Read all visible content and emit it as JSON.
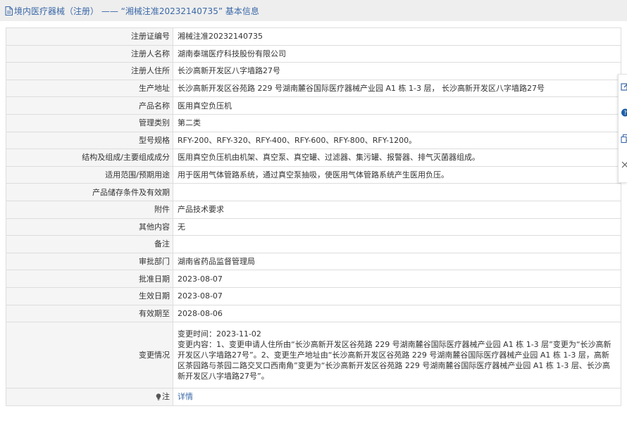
{
  "header": {
    "title": "境内医疗器械（注册） —— “湘械注准20232140735” 基本信息",
    "icon": "document-icon"
  },
  "rows": [
    {
      "label": "注册证编号",
      "value": "湘械注准20232140735"
    },
    {
      "label": "注册人名称",
      "value": "湖南泰瑞医疗科技股份有限公司"
    },
    {
      "label": "注册人住所",
      "value": "长沙高新开发区八字墙路27号"
    },
    {
      "label": "生产地址",
      "value": "长沙高新开发区谷苑路 229 号湖南麓谷国际医疗器械产业园 A1 栋 1-3 层， 长沙高新开发区八字墙路27号"
    },
    {
      "label": "产品名称",
      "value": "医用真空负压机"
    },
    {
      "label": "管理类别",
      "value": "第二类"
    },
    {
      "label": "型号规格",
      "value": "RFY-200、RFY-320、RFY-400、RFY-600、RFY-800、RFY-1200。"
    },
    {
      "label": "结构及组成/主要组成成分",
      "value": "医用真空负压机由机架、真空泵、真空罐、过滤器、集污罐、报警器、排气灭菌器组成。"
    },
    {
      "label": "适用范围/预期用途",
      "value": "用于医用气体管路系统，通过真空泵抽吸，使医用气体管路系统产生医用负压。"
    },
    {
      "label": "产品储存条件及有效期",
      "value": ""
    },
    {
      "label": "附件",
      "value": "产品技术要求"
    },
    {
      "label": "其他内容",
      "value": "无"
    },
    {
      "label": "备注",
      "value": ""
    },
    {
      "label": "审批部门",
      "value": "湖南省药品监督管理局"
    },
    {
      "label": "批准日期",
      "value": "2023-08-07"
    },
    {
      "label": "生效日期",
      "value": "2023-08-07"
    },
    {
      "label": "有效期至",
      "value": "2028-08-06"
    }
  ],
  "change": {
    "label": "变更情况",
    "time": "变更时间：2023-11-02",
    "content": "变更内容：1、变更申请人住所由“长沙高新开发区谷苑路 229 号湖南麓谷国际医疗器械产业园 A1 栋 1-3 层”变更为“长沙高新开发区八字墙路27号”。2、变更生产地址由“长沙高新开发区谷苑路 229 号湖南麓谷国际医疗器械产业园 A1 栋 1-3 层，高新区茶园路与茶园二路交叉口西南角”变更为“长沙高新开发区谷苑路 229 号湖南麓谷国际医疗器械产业园 A1 栋 1-3 层、长沙高新开发区八字墙路27号”。"
  },
  "note": {
    "label": "注",
    "icon": "lightbulb-icon",
    "link": "详情"
  },
  "toolbar": {
    "icons": [
      "edit-icon",
      "help-icon",
      "copy-icon",
      "close-icon"
    ]
  },
  "colors": {
    "link": "#3a68a8",
    "header_bg": "#eeeeee",
    "label_bg": "#f5f5f5",
    "border": "#dddddd"
  }
}
